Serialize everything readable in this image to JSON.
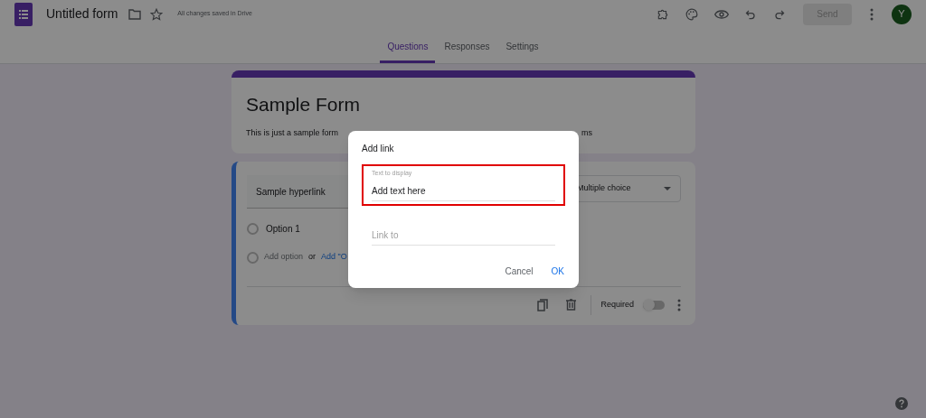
{
  "header": {
    "title": "Untitled form",
    "save_status": "All changes saved in Drive",
    "send_button": {
      "label": "Send",
      "disabled": true
    },
    "avatar_letter": "Y"
  },
  "tabs": [
    {
      "label": "Questions",
      "selected": true
    },
    {
      "label": "Responses",
      "selected": false
    },
    {
      "label": "Settings",
      "selected": false
    }
  ],
  "form": {
    "title": "Sample Form",
    "description_parts": [
      "This is just a sample form",
      "ms"
    ]
  },
  "question": {
    "title": "Sample hyperlink",
    "type": "Multiple choice",
    "options": [
      "Option 1"
    ],
    "add_option": "Add option",
    "or": "or",
    "add_other": "Add \"O",
    "required_label": "Required",
    "required_on": false
  },
  "dialog": {
    "title": "Add link",
    "fields": [
      {
        "label": "Text to display",
        "value": "Add text here",
        "highlighted": true
      },
      {
        "placeholder": "Link to",
        "highlighted": false
      }
    ],
    "buttons": [
      {
        "label": "Cancel",
        "kind": "secondary"
      },
      {
        "label": "OK",
        "kind": "primary"
      }
    ]
  }
}
